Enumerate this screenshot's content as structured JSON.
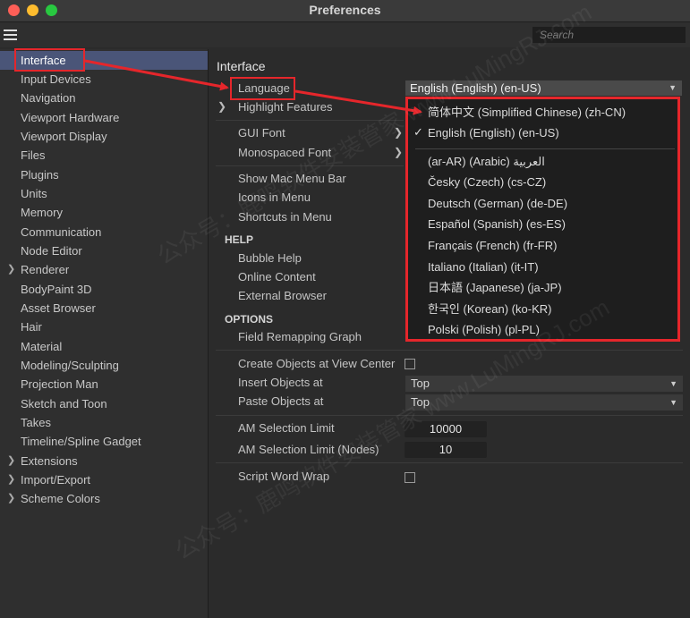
{
  "window": {
    "title": "Preferences"
  },
  "toolbar": {
    "search_placeholder": "Search"
  },
  "sidebar": {
    "items": [
      {
        "label": "Interface",
        "selected": true,
        "expandable": false
      },
      {
        "label": "Input Devices",
        "expandable": false
      },
      {
        "label": "Navigation",
        "expandable": false
      },
      {
        "label": "Viewport Hardware",
        "expandable": false
      },
      {
        "label": "Viewport Display",
        "expandable": false
      },
      {
        "label": "Files",
        "expandable": false
      },
      {
        "label": "Plugins",
        "expandable": false
      },
      {
        "label": "Units",
        "expandable": false
      },
      {
        "label": "Memory",
        "expandable": false
      },
      {
        "label": "Communication",
        "expandable": false
      },
      {
        "label": "Node Editor",
        "expandable": false
      },
      {
        "label": "Renderer",
        "expandable": true
      },
      {
        "label": "BodyPaint 3D",
        "expandable": false
      },
      {
        "label": "Asset Browser",
        "expandable": false
      },
      {
        "label": "Hair",
        "expandable": false
      },
      {
        "label": "Material",
        "expandable": false
      },
      {
        "label": "Modeling/Sculpting",
        "expandable": false
      },
      {
        "label": "Projection Man",
        "expandable": false
      },
      {
        "label": "Sketch and Toon",
        "expandable": false
      },
      {
        "label": "Takes",
        "expandable": false
      },
      {
        "label": "Timeline/Spline Gadget",
        "expandable": false
      },
      {
        "label": "Extensions",
        "expandable": true
      },
      {
        "label": "Import/Export",
        "expandable": true
      },
      {
        "label": "Scheme Colors",
        "expandable": true
      }
    ]
  },
  "main": {
    "heading": "Interface",
    "language_label": "Language",
    "language_value": "English (English) (en-US)",
    "highlight_features": "Highlight Features",
    "gui_font": "GUI Font",
    "monospaced_font": "Monospaced Font",
    "show_mac_menu_bar": "Show Mac Menu Bar",
    "icons_in_menu": "Icons in Menu",
    "shortcuts_in_menu": "Shortcuts in Menu",
    "help_section": "HELP",
    "bubble_help": "Bubble Help",
    "online_content": "Online Content",
    "external_browser": "External Browser",
    "options_section": "OPTIONS",
    "field_remapping_graph": "Field Remapping Graph",
    "create_objects_at_view_center": "Create Objects at View Center",
    "insert_objects_at": "Insert Objects at",
    "insert_objects_value": "Top",
    "paste_objects_at": "Paste Objects at",
    "paste_objects_value": "Top",
    "am_selection_limit": "AM Selection Limit",
    "am_selection_limit_value": "10000",
    "am_selection_limit_nodes": "AM Selection Limit (Nodes)",
    "am_selection_limit_nodes_value": "10",
    "script_word_wrap": "Script Word Wrap"
  },
  "language_popup": {
    "options": [
      {
        "label": "简体中文 (Simplified Chinese) (zh-CN)",
        "checked": false
      },
      {
        "label": "English (English) (en-US)",
        "checked": true
      },
      {
        "label": "(ar-AR) (Arabic) العربية",
        "checked": false
      },
      {
        "label": "Česky (Czech) (cs-CZ)",
        "checked": false
      },
      {
        "label": "Deutsch (German) (de-DE)",
        "checked": false
      },
      {
        "label": "Español (Spanish) (es-ES)",
        "checked": false
      },
      {
        "label": "Français (French) (fr-FR)",
        "checked": false
      },
      {
        "label": "Italiano (Italian) (it-IT)",
        "checked": false
      },
      {
        "label": "日本語 (Japanese) (ja-JP)",
        "checked": false
      },
      {
        "label": "한국인 (Korean) (ko-KR)",
        "checked": false
      },
      {
        "label": "Polski (Polish) (pl-PL)",
        "checked": false
      }
    ],
    "checkmark_glyph": "✓"
  },
  "watermark": {
    "text": "公众号：鹿鸣软件安装管家 www.LuMingRJ.com"
  },
  "colors": {
    "accent_selection": "#4a5578",
    "annotation_red": "#e5262b"
  }
}
